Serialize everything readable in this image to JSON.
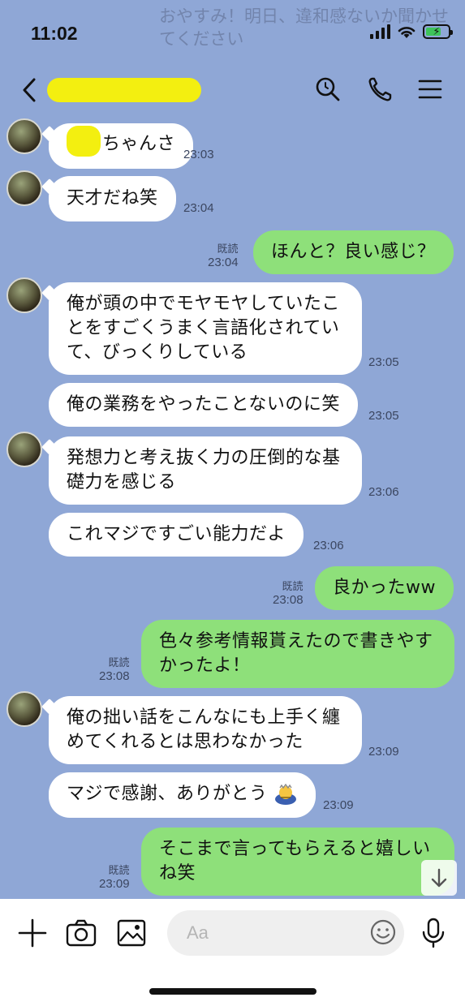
{
  "status": {
    "time": "11:02",
    "notification_ghost": "おやすみ！明日、違和感ないか聞かせてください"
  },
  "header": {
    "title": "",
    "icons": [
      "back-icon",
      "search-icon",
      "phone-icon",
      "menu-icon"
    ]
  },
  "messages": [
    {
      "side": "in",
      "text": "ちゃんさ",
      "time": "23:03",
      "name_redacted": true
    },
    {
      "side": "in",
      "text": "天才だね笑",
      "time": "23:04"
    },
    {
      "side": "out",
      "text": "ほんと？良い感じ？",
      "time": "23:04",
      "read": "既読"
    },
    {
      "side": "in",
      "text": "俺が頭の中でモヤモヤしていたことをすごくうまく言語化されていて、びっくりしている",
      "lines": [
        "俺が頭の中でモヤモヤしていたこ",
        "とをすごくうまく言語化されてい",
        "て、びっくりしている"
      ],
      "time": "23:05"
    },
    {
      "side": "in",
      "text": "俺の業務をやったことないのに笑",
      "time": "23:05"
    },
    {
      "side": "in",
      "lines": [
        "発想力と考え抜く力の圧倒的な基",
        "礎力を感じる"
      ],
      "time": "23:06"
    },
    {
      "side": "in",
      "text": "これマジですごい能力だよ",
      "time": "23:06"
    },
    {
      "side": "out",
      "text": "良かったww",
      "time": "23:08",
      "read": "既読"
    },
    {
      "side": "out",
      "lines": [
        "色々参考情報貰えたので書きやす",
        "かったよ！"
      ],
      "time": "23:08",
      "read": "既読"
    },
    {
      "side": "in",
      "lines": [
        "俺の拙い話をこんなにも上手く纏",
        "めてくれるとは思わなかった"
      ],
      "time": "23:09"
    },
    {
      "side": "in",
      "text": "マジで感謝、ありがとう",
      "time": "23:09",
      "emoji": "bowing-person"
    },
    {
      "side": "out",
      "lines": [
        "そこまで言ってもらえると嬉しい",
        "ね笑"
      ],
      "time": "23:09",
      "read": "既読"
    }
  ],
  "input": {
    "placeholder": "Aa",
    "icons": [
      "plus-icon",
      "camera-icon",
      "image-icon",
      "smiley-icon",
      "mic-icon"
    ]
  },
  "colors": {
    "background": "#8fa7d6",
    "incoming": "#ffffff",
    "outgoing": "#8ee07a",
    "redaction": "#f3ef10"
  }
}
